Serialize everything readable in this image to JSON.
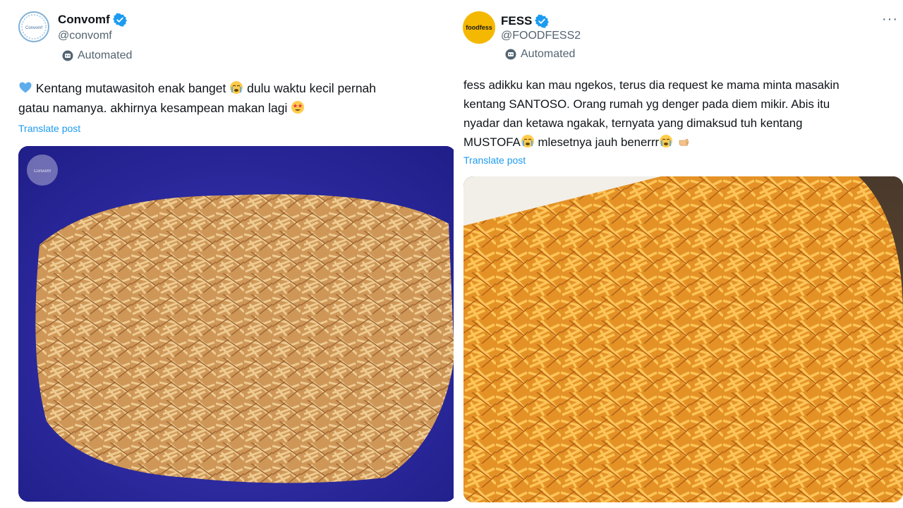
{
  "left_post": {
    "name": "Convomf",
    "handle": "@convomf",
    "label": "Automated",
    "text_line1": "Kentang mutawasitoh enak banget",
    "text_line1b": "dulu waktu kecil pernah",
    "text_line2": "gatau namanya. akhirnya kesampean makan lagi",
    "translate": "Translate post",
    "avatar_text": "Convomf",
    "watermark_text": "Convomf"
  },
  "right_post": {
    "name": "FESS",
    "handle": "@FOODFESS2",
    "label": "Automated",
    "avatar_text": "foodfess",
    "text_line1": "fess adikku kan mau ngekos, terus dia request ke mama minta masakin",
    "text_line2": "kentang SANTOSO. Orang rumah yg denger pada diem mikir. Abis itu",
    "text_line3": "nyadar dan ketawa ngakak, ternyata yang dimaksud tuh kentang",
    "text_line4a": "MUSTOFA",
    "text_line4b": "mlesetnya jauh benerrr",
    "translate": "Translate post",
    "more": "···"
  },
  "colors": {
    "verified": "#1d9bf0",
    "link": "#1d9bf0",
    "secondary_text": "#536471",
    "left_media_bg": "#2c2a9e",
    "right_avatar_bg": "#f5b800"
  },
  "icons": [
    "verified-badge-icon",
    "bot-icon",
    "blue-heart-emoji",
    "crying-face-emoji",
    "star-struck-emoji",
    "hand-emoji",
    "more-icon"
  ]
}
